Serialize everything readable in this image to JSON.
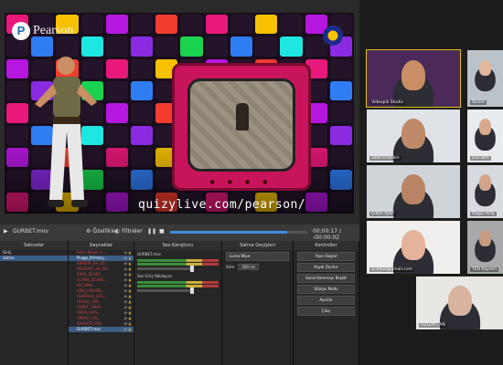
{
  "preview": {
    "logo_letter": "P",
    "logo_text": "Pearson",
    "watermark": "quizylive.com/pearson/",
    "tile_colors": [
      "#e8197a",
      "#19d24f",
      "#f6c100",
      "#2f7df2",
      "#b517e0",
      "#1ee6e0",
      "#f23d2f",
      "#8a2be2"
    ]
  },
  "transport": {
    "file": "GURBET.mov",
    "filters_label": "Özellikler",
    "filters2_label": "Filtreler",
    "time": "00:00:17 / -00:00:02",
    "progress": 0.85
  },
  "docks": {
    "scenes": {
      "title": "Sahneler",
      "items": [
        "Giriş",
        "Sahne"
      ],
      "selected": 1
    },
    "sources": {
      "title": "Kaynaklar",
      "items": [
        "Adsız Başlık.in...",
        "PLogo_Primary...",
        "KEKERR_SH_SS...",
        "PRESENT_SH_NO...",
        "KARA_SEHRE...",
        "SCHNK_BCSNE...",
        "MZ_NNN...",
        "ARB_LOKUSN...",
        "ALBERGO_ESS...",
        "HESKIL_SSK...",
        "DEBAT_SEHB...",
        "PARALLAKS...",
        "ARKAD_CAL...",
        "KARARSI_SSK...",
        "GURBET.mov"
      ],
      "highlighted": [
        1,
        14
      ]
    },
    "mixer": {
      "title": "Ses Karıştırıcı",
      "channels": [
        {
          "name": "GURBET.mov",
          "db": "0.0 dB"
        },
        {
          "name": "Ses Giriş Yakalayıcı",
          "db": "0.0 dB"
        }
      ]
    },
    "transitions": {
      "title": "Sahne Geçişleri",
      "type": "Luma Wipe",
      "duration_label": "Süre",
      "duration": "300 ms"
    },
    "controls": {
      "title": "Kontroller",
      "buttons": [
        "Yayın Başlat",
        "Kaydı Durdur",
        "Sanal Kamerayı Başlat",
        "Stüdyo Modu",
        "Ayarlar",
        "Çıkış"
      ]
    }
  },
  "participants": [
    {
      "name": "Videopik Studio"
    },
    {
      "name": "Sinem"
    },
    {
      "name": "Sibel Erözden"
    },
    {
      "name": "Ece Sert"
    },
    {
      "name": "Erkan Aykil"
    },
    {
      "name": "Özgür ATIŞ"
    },
    {
      "name": "ZLKRuk@gmail.com"
    },
    {
      "name": "TED Kayseri"
    },
    {
      "name": "ÖZLEM CAN"
    }
  ]
}
